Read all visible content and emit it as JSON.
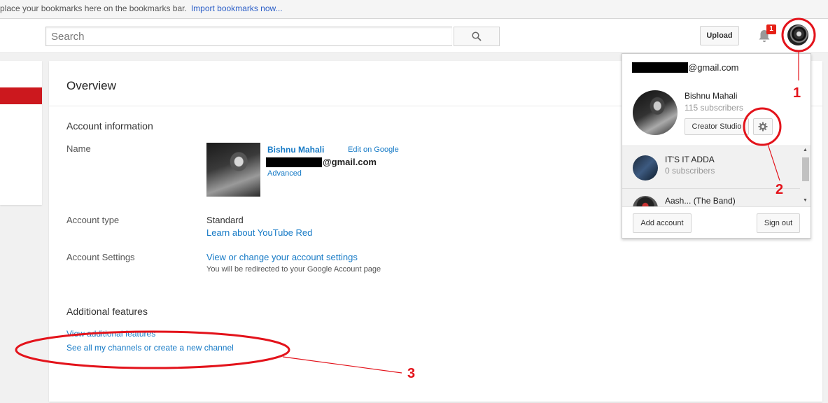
{
  "bookmarks_bar": {
    "text": "place your bookmarks here on the bookmarks bar.",
    "import_link": "Import bookmarks now..."
  },
  "masthead": {
    "search_placeholder": "Search",
    "upload_label": "Upload",
    "notification_count": "1"
  },
  "overview": {
    "title": "Overview",
    "account_info_title": "Account information",
    "name_label": "Name",
    "user_name": "Bishnu Mahali",
    "edit_on_google": "Edit on Google",
    "email_suffix": "@gmail.com",
    "advanced_link": "Advanced",
    "account_type_label": "Account type",
    "account_type_value": "Standard",
    "learn_red_link": "Learn about YouTube Red",
    "account_settings_label": "Account Settings",
    "account_settings_link": "View or change your account settings",
    "redirect_note": "You will be redirected to your Google Account page",
    "additional_features_title": "Additional features",
    "view_additional_link": "View additional features",
    "channels_link": "See all my channels or create a new channel"
  },
  "account_menu": {
    "email_suffix": "@gmail.com",
    "user_name": "Bishnu Mahali",
    "subscribers": "115 subscribers",
    "creator_studio": "Creator Studio",
    "channels": [
      {
        "name": "IT'S IT ADDA",
        "subscribers": "0 subscribers"
      },
      {
        "name": "Aash... (The Band)",
        "subscribers": ""
      }
    ],
    "add_account": "Add account",
    "sign_out": "Sign out"
  },
  "annotations": {
    "one": "1",
    "two": "2",
    "three": "3",
    "color": "#e3131b"
  }
}
